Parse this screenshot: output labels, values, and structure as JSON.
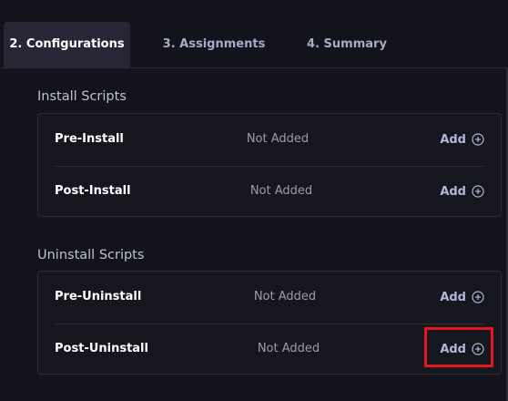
{
  "tabs": [
    {
      "label": "2. Configurations",
      "active": true
    },
    {
      "label": "3. Assignments",
      "active": false
    },
    {
      "label": "4. Summary",
      "active": false
    }
  ],
  "install_scripts": {
    "title": "Install Scripts",
    "rows": [
      {
        "label": "Pre-Install",
        "status": "Not Added",
        "action": "Add"
      },
      {
        "label": "Post-Install",
        "status": "Not Added",
        "action": "Add"
      }
    ]
  },
  "uninstall_scripts": {
    "title": "Uninstall Scripts",
    "rows": [
      {
        "label": "Pre-Uninstall",
        "status": "Not Added",
        "action": "Add"
      },
      {
        "label": "Post-Uninstall",
        "status": "Not Added",
        "action": "Add"
      }
    ]
  },
  "icons": {
    "add": "plus-circle-icon"
  },
  "colors": {
    "background": "#13131b",
    "active_tab": "#262634",
    "add_text": "#b4b6d8",
    "highlight": "#e5161e"
  }
}
